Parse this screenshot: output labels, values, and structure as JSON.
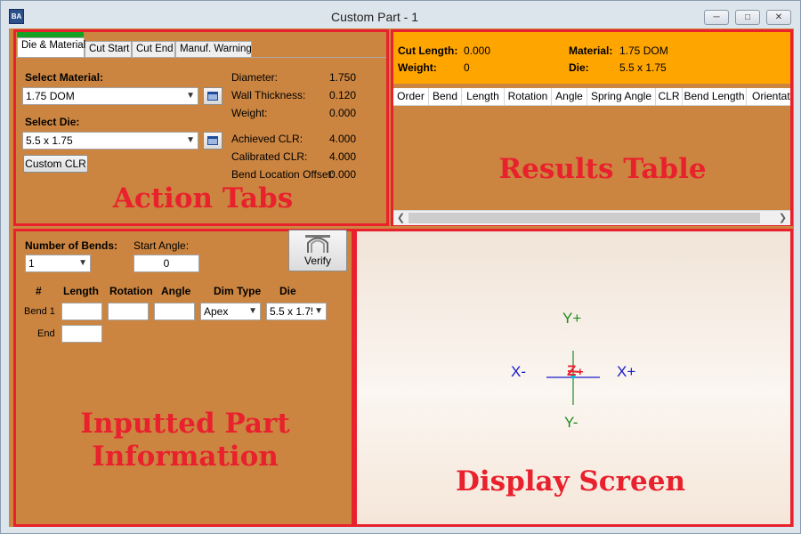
{
  "window": {
    "title": "Custom Part - 1",
    "icon": "app-logo-icon",
    "controls": [
      "minimize-icon",
      "restore-icon",
      "close-icon"
    ]
  },
  "tabs": [
    "Die & Material",
    "Cut Start",
    "Cut End",
    "Manuf. Warning"
  ],
  "die_material": {
    "select_material_label": "Select Material:",
    "material_value": "1.75 DOM",
    "select_die_label": "Select Die:",
    "die_value": "5.5 x 1.75",
    "custom_clr_label": "Custom CLR",
    "properties": [
      {
        "label": "Diameter:",
        "value": "1.750"
      },
      {
        "label": "Wall Thickness:",
        "value": "0.120"
      },
      {
        "label": "Weight:",
        "value": "0.000"
      },
      {
        "label": "Achieved CLR:",
        "value": "4.000"
      },
      {
        "label": "Calibrated CLR:",
        "value": "4.000"
      },
      {
        "label": "Bend Location Offset:",
        "value": "0.000"
      }
    ]
  },
  "results": {
    "cut_length_label": "Cut Length:",
    "cut_length_value": "0.000",
    "weight_label": "Weight:",
    "weight_value": "0",
    "material_label": "Material:",
    "material_value": "1.75 DOM",
    "die_label": "Die:",
    "die_value": "5.5 x 1.75",
    "columns": [
      "Order",
      "Bend",
      "Length",
      "Rotation",
      "Angle",
      "Spring Angle",
      "CLR",
      "Bend Length",
      "Orientation"
    ]
  },
  "part_info": {
    "num_bends_label": "Number of Bends:",
    "num_bends_value": "1",
    "start_angle_label": "Start Angle:",
    "start_angle_value": "0",
    "verify_label": "Verify",
    "col_headers": [
      "#",
      "Length",
      "Rotation",
      "Angle",
      "Dim Type",
      "Die"
    ],
    "bend_row_label": "Bend 1",
    "dim_type_value": "Apex",
    "die_value": "5.5 x 1.75",
    "end_row_label": "End"
  },
  "display": {
    "y_plus": "Y+",
    "y_minus": "Y-",
    "x_plus": "X+",
    "x_minus": "X-",
    "z_label": "Z"
  },
  "annotations": {
    "action_tabs": "Action Tabs",
    "results_table": "Results Table",
    "part_info_line1": "Inputted Part",
    "part_info_line2": "Information",
    "display_screen": "Display Screen"
  },
  "colors": {
    "panel": "#cc8540",
    "highlight": "#e8212d",
    "banner": "#ffa500",
    "tab_accent": "#17a124",
    "y_axis": "#1e8c1e",
    "x_axis": "#1a1acc",
    "z_axis": "#e8212d"
  }
}
